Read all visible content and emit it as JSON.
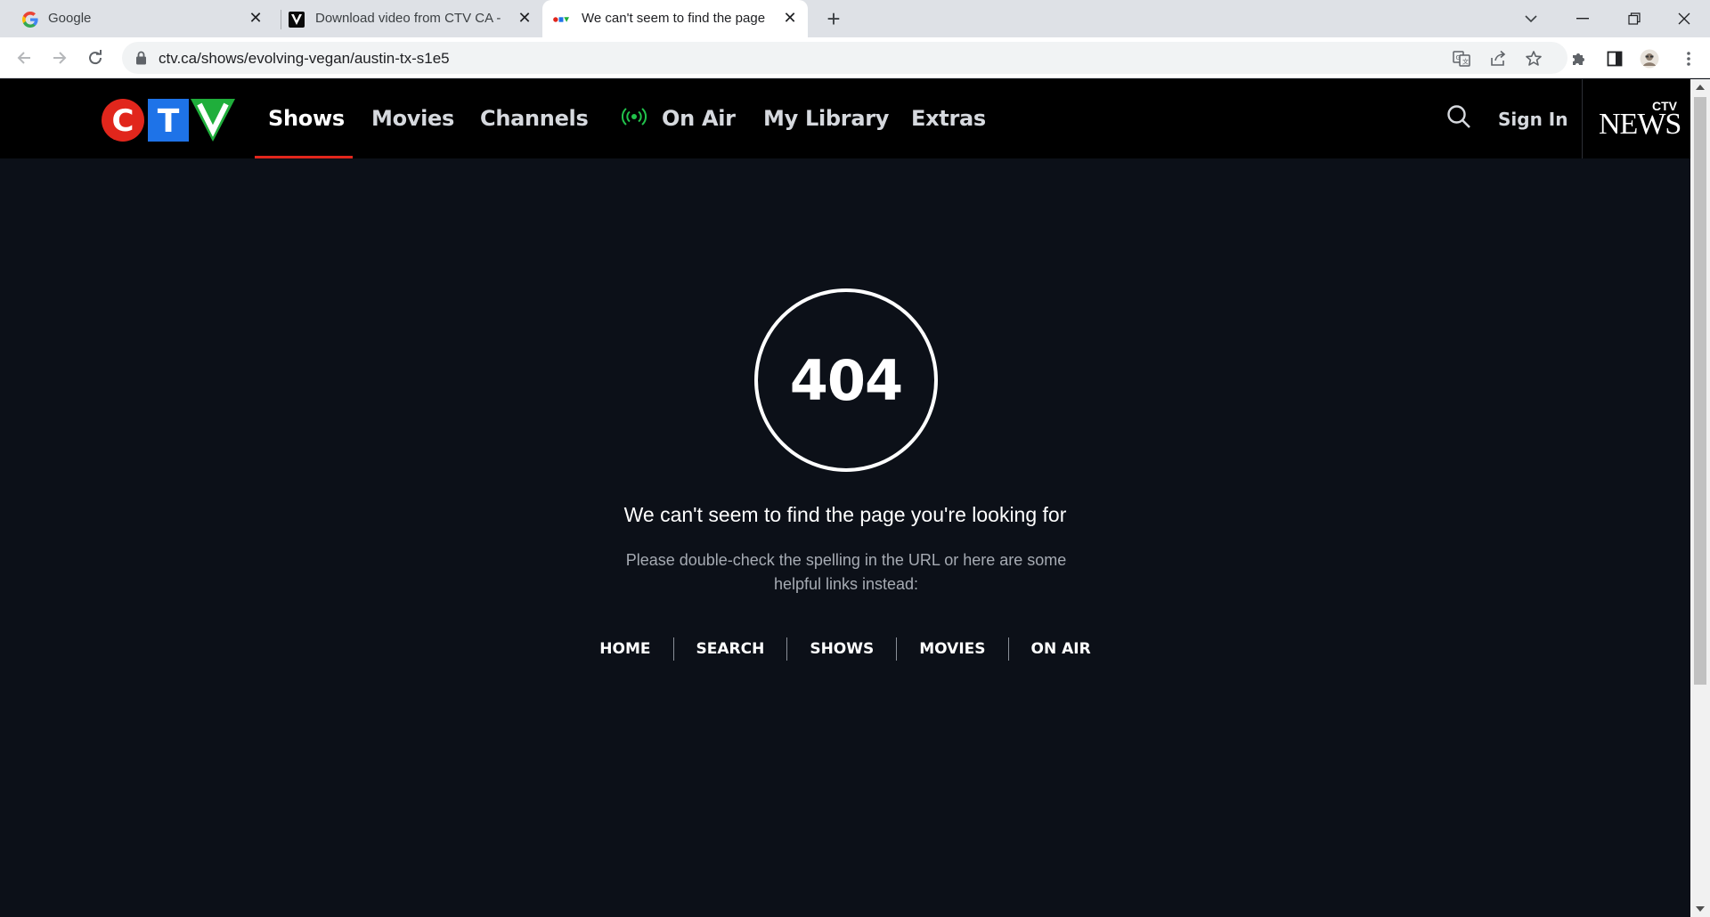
{
  "browser": {
    "tabs": [
      {
        "title": "Google",
        "favicon": "google-g-icon"
      },
      {
        "title": "Download video from CTV CA - V",
        "favicon": "v-logo-icon"
      },
      {
        "title": "We can't seem to find the page y",
        "favicon": "ctv-mini-logo-icon",
        "active": true
      }
    ],
    "url": "ctv.ca/shows/evolving-vegan/austin-tx-s1e5"
  },
  "site": {
    "logo": {
      "c": "C",
      "t": "T",
      "v": "V",
      "colors": {
        "c": "#e1261c",
        "t": "#1e73e8",
        "v": "#1fae3b"
      }
    },
    "nav": {
      "shows": "Shows",
      "movies": "Movies",
      "channels": "Channels",
      "on_air": "On Air",
      "my_library": "My Library",
      "extras": "Extras"
    },
    "sign_in": "Sign In",
    "news_logo": {
      "ctv": "CTV",
      "word": "NEWS"
    },
    "accent_color": "#e1261c",
    "live_color": "#21c24b"
  },
  "error": {
    "code": "404",
    "heading": "We can't seem to find the page you're looking for",
    "subtext": "Please double-check the spelling in the URL or here are some helpful links instead:",
    "links": {
      "home": "HOME",
      "search": "SEARCH",
      "shows": "SHOWS",
      "movies": "MOVIES",
      "on_air": "ON AIR"
    }
  }
}
